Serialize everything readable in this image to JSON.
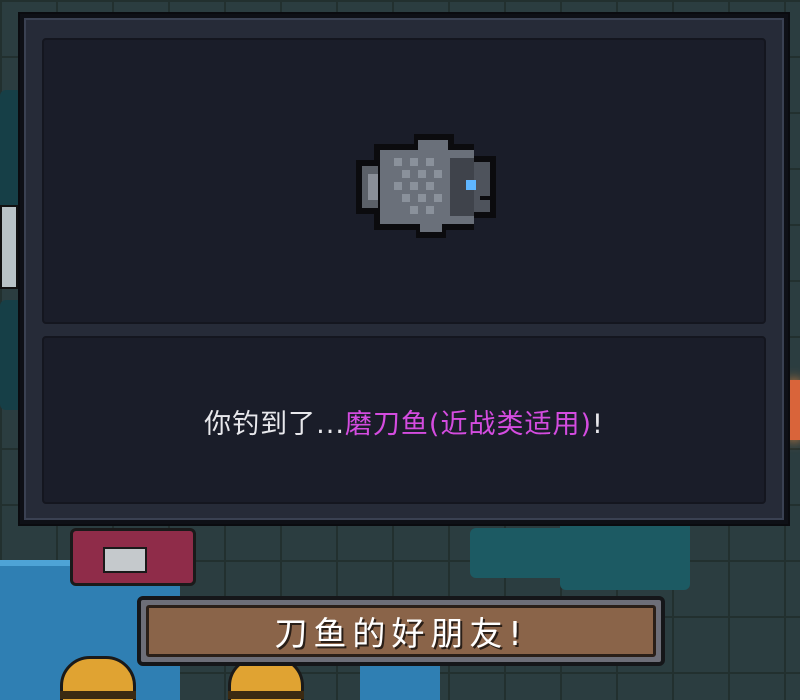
{
  "dialog": {
    "catch_prefix": "你钓到了...",
    "item_name": "磨刀鱼(近战类适用)",
    "catch_suffix": "!",
    "item_icon": "fish-icon"
  },
  "button": {
    "label": "刀鱼的好朋友!"
  },
  "colors": {
    "item_highlight": "#d44ce0",
    "button_fill": "#8a6449",
    "panel_bg": "#1a1d29"
  }
}
